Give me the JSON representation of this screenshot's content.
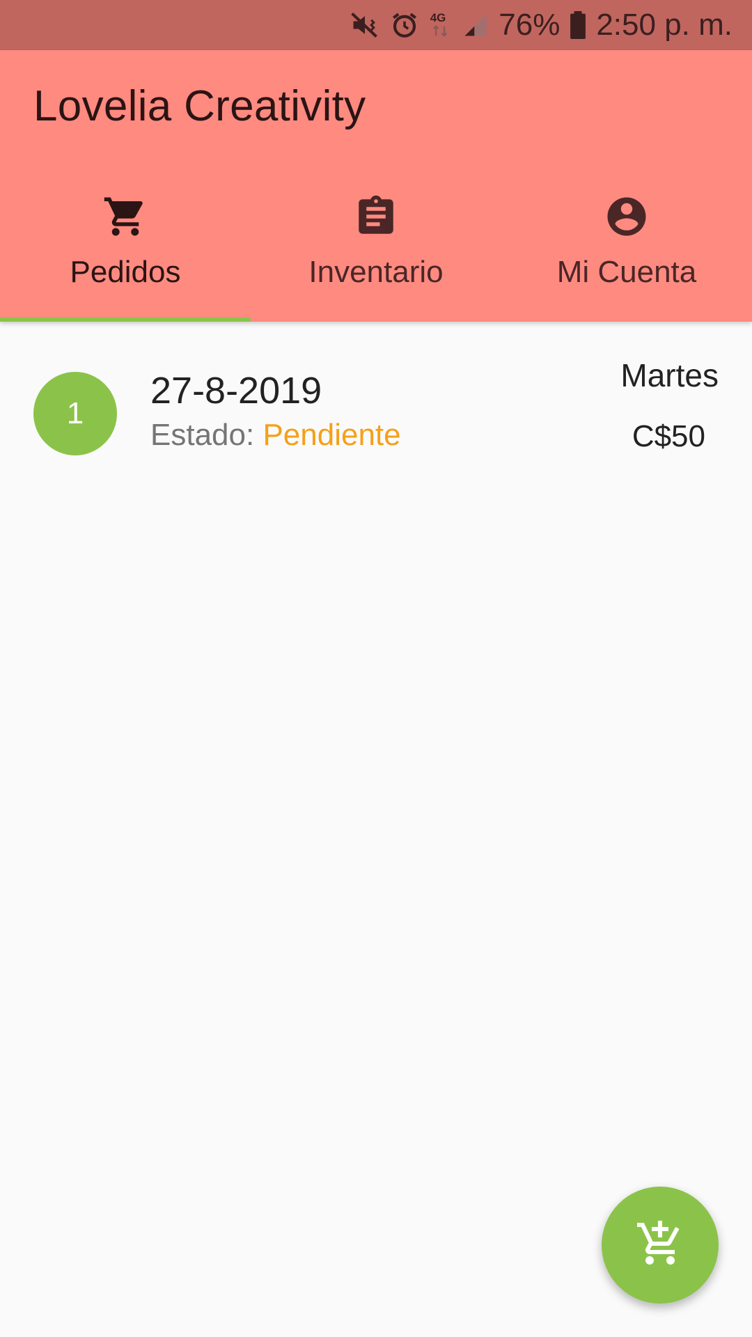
{
  "status_bar": {
    "battery_percent": "76%",
    "time": "2:50 p. m.",
    "network": "4G",
    "icons": [
      "mute-vibrate-icon",
      "alarm-icon",
      "4g-icon",
      "signal-icon",
      "battery-icon"
    ]
  },
  "app_bar": {
    "title": "Lovelia Creativity",
    "background_color": "#ff8a80"
  },
  "tabs": [
    {
      "label": "Pedidos",
      "icon": "shopping-cart-icon",
      "active": true
    },
    {
      "label": "Inventario",
      "icon": "clipboard-icon",
      "active": false
    },
    {
      "label": "Mi Cuenta",
      "icon": "account-circle-icon",
      "active": false
    }
  ],
  "orders": [
    {
      "number": "1",
      "date": "27-8-2019",
      "status_label": "Estado:",
      "status_value": "Pendiente",
      "day": "Martes",
      "price": "C$50"
    }
  ],
  "fab": {
    "icon": "add-shopping-cart-icon"
  },
  "colors": {
    "accent": "#8bc34a",
    "status_pending": "#f5a01a",
    "status_bar": "#c0665f"
  }
}
